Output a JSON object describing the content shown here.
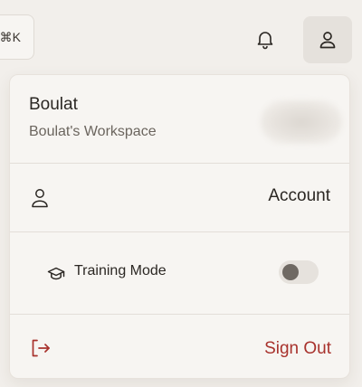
{
  "topbar": {
    "shortcut_hint": "⌘K",
    "bell_icon": "bell-icon",
    "user_icon": "user-icon"
  },
  "menu": {
    "user": {
      "name": "Boulat",
      "workspace": "Boulat's Workspace"
    },
    "account": {
      "icon": "user-icon",
      "label": "Account"
    },
    "training_mode": {
      "icon": "graduation-cap-icon",
      "label": "Training Mode",
      "enabled": false
    },
    "sign_out": {
      "icon": "sign-out-icon",
      "label": "Sign Out"
    }
  },
  "colors": {
    "background": "#f2efeb",
    "menu_background": "#f7f5f2",
    "danger": "#a8322d",
    "text": "#2b2723",
    "muted_text": "#6b655e"
  }
}
